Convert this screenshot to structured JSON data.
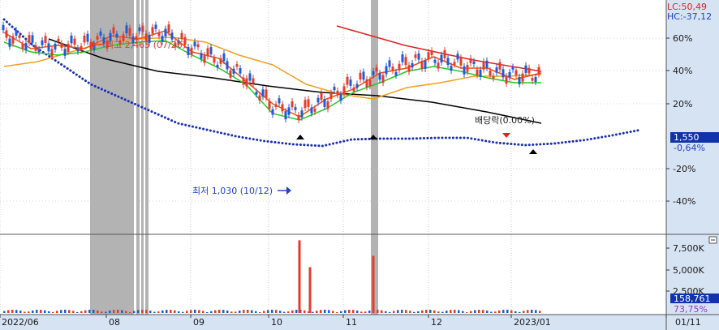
{
  "header": {
    "lc_label": "LC:50,49",
    "hc_label": "HC:-37,12"
  },
  "colors": {
    "price_red": "#e53c2a",
    "price_blue": "#1f5bd6",
    "dotted_line": "#1b2fb8",
    "black_line": "#000000",
    "red_line": "#e02020",
    "orange_line": "#f0a020",
    "green_line": "#22cc22",
    "short_line": "#f05010",
    "shade": "#b3b3b3",
    "axis_text": "#1a1a1a",
    "current_box": "#1133aa"
  },
  "annotations": {
    "high": "최고 2,465 (07/26)",
    "low": "최저 1,030 (10/12)",
    "dividend": "배당락(0.00%)"
  },
  "price_axis": {
    "current_value": "1,550",
    "current_change": "-0,64%"
  },
  "volume_axis": {
    "current_value": "158,761",
    "current_pct": "73,75%"
  },
  "chart_data": [
    {
      "type": "line",
      "title": "",
      "y_axis_ticks": [
        "60%",
        "40%",
        "20%",
        "-20%",
        "-40%"
      ],
      "x_axis_ticks": [
        "2022/06",
        "08",
        "09",
        "10",
        "11",
        "12",
        "2023/01",
        "01/11"
      ],
      "series": [
        {
          "name": "",
          "role": "dotted-blue",
          "values": [
            1.72,
            1.56,
            1.44,
            1.32,
            1.24,
            1.16,
            1.08,
            1.04,
            1.0,
            0.97,
            0.95,
            0.94,
            0.98,
            0.985,
            0.985,
            0.99,
            0.99,
            0.96,
            0.945,
            0.955,
            0.975,
            1.005,
            1.04
          ]
        },
        {
          "name": "",
          "role": "black",
          "values": [
            1.6,
            1.48,
            1.4,
            1.36,
            1.31,
            1.27,
            1.25,
            1.21,
            1.15,
            1.08
          ]
        },
        {
          "name": "",
          "role": "red",
          "values": [
            1.68,
            1.56,
            1.47,
            1.4
          ]
        },
        {
          "name": "",
          "role": "orange",
          "values": [
            1.43,
            1.46,
            1.52,
            1.58,
            1.6,
            1.61,
            1.58,
            1.5,
            1.44,
            1.32,
            1.26,
            1.23,
            1.3,
            1.33,
            1.37,
            1.37,
            1.38
          ]
        },
        {
          "name": "",
          "role": "green",
          "values": [
            1.58,
            1.52,
            1.5,
            1.52,
            1.56,
            1.58,
            1.59,
            1.5,
            1.42,
            1.32,
            1.14,
            1.1,
            1.17,
            1.27,
            1.33,
            1.4,
            1.43,
            1.4,
            1.36,
            1.33,
            1.33
          ]
        }
      ],
      "shaded_periods": [
        "2022/07 (late)",
        "2022/08 (early)",
        "2022/11 (mid)"
      ],
      "events": [
        {
          "date": "07/26",
          "label": "최고 2,465"
        },
        {
          "date": "10/12",
          "label": "최저 1,030"
        },
        {
          "date": "2022/12",
          "label": "배당락(0.00%)"
        }
      ]
    },
    {
      "type": "bar",
      "title": "",
      "y_axis_ticks": [
        "7,500K",
        "5,000K",
        "2,500K"
      ],
      "categories": [
        "2022/06",
        "08",
        "09",
        "10",
        "11",
        "12",
        "2023/01"
      ],
      "description": "volume bars",
      "peaks": [
        {
          "date": "10/13",
          "value_k": 8400
        },
        {
          "date": "10/17",
          "value_k": 5300
        },
        {
          "date": "11/10",
          "value_k": 6600
        }
      ]
    }
  ]
}
